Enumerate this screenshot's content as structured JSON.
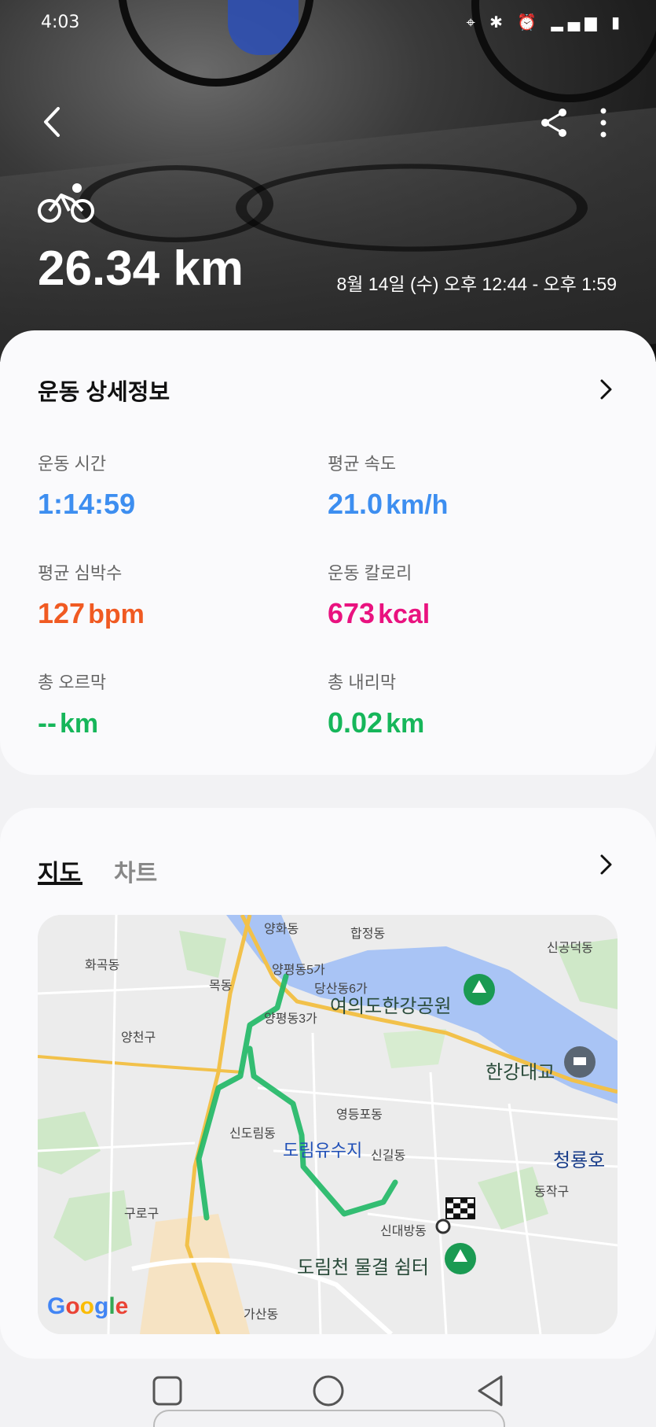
{
  "status_bar": {
    "time": "4:03"
  },
  "hero": {
    "distance": "26.34 km",
    "datetime": "8월 14일 (수) 오후 12:44 - 오후 1:59"
  },
  "details": {
    "title": "운동 상세정보",
    "metrics": [
      {
        "label": "운동 시간",
        "value": "1:14:59",
        "unit": "",
        "color": "#3d8ef0"
      },
      {
        "label": "평균 속도",
        "value": "21.0",
        "unit": "km/h",
        "color": "#3d8ef0"
      },
      {
        "label": "평균 심박수",
        "value": "127",
        "unit": "bpm",
        "color": "#f05a22"
      },
      {
        "label": "운동 칼로리",
        "value": "673",
        "unit": "kcal",
        "color": "#e9127f"
      },
      {
        "label": "총 오르막",
        "value": "--",
        "unit": "km",
        "color": "#16b65a"
      },
      {
        "label": "총 내리막",
        "value": "0.02",
        "unit": "km",
        "color": "#16b65a"
      }
    ]
  },
  "map_section": {
    "tabs": [
      {
        "label": "지도",
        "active": true
      },
      {
        "label": "차트",
        "active": false
      }
    ],
    "labels": {
      "yanghwa": "양화동",
      "hapjeong": "합정동",
      "singongdeok": "신공덕동",
      "hwagok": "화곡동",
      "yangpyeong5": "양평동5가",
      "mok": "목동",
      "dangsan6": "당산동6가",
      "yeouido_park": "여의도한강공원",
      "yangpyeong3": "양평동3가",
      "yangcheon": "양천구",
      "hangang_bridge": "한강대교",
      "yeongdeungpo": "영등포동",
      "sindorim": "신도림동",
      "dorim_reservoir": "도림유수지",
      "singil": "신길동",
      "cheongryong": "청룡호",
      "dongjak": "동작구",
      "guro": "구로구",
      "sindaebang": "신대방동",
      "dorimcheon": "도림천 물결 쉼터",
      "gasan": "가산동",
      "google": "Google"
    },
    "route_color": "#1fb865"
  }
}
